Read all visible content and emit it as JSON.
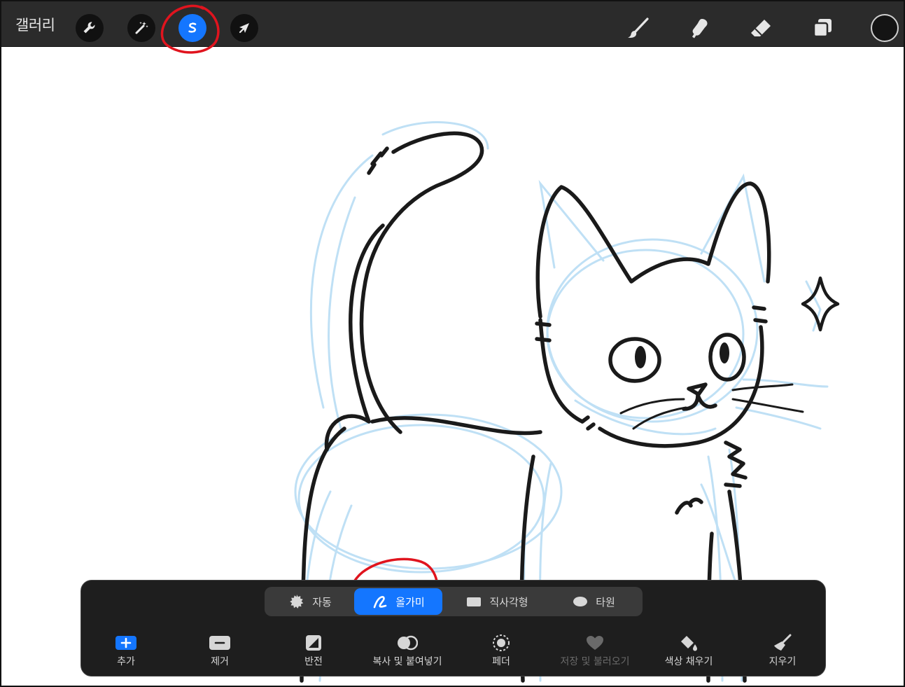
{
  "app": {
    "gallery_label": "갤러리"
  },
  "toolbar": {
    "left_tools": [
      {
        "name": "actions",
        "icon": "wrench-icon"
      },
      {
        "name": "adjustments",
        "icon": "magic-wand-icon"
      },
      {
        "name": "selection",
        "icon": "selection-s-icon",
        "active": true
      },
      {
        "name": "transform",
        "icon": "arrow-cursor-icon"
      }
    ],
    "right_tools": [
      {
        "name": "brush",
        "icon": "brush-icon"
      },
      {
        "name": "smudge",
        "icon": "smudge-icon"
      },
      {
        "name": "eraser",
        "icon": "eraser-icon"
      },
      {
        "name": "layers",
        "icon": "layers-icon"
      }
    ],
    "current_color": "#141414"
  },
  "selection_panel": {
    "modes": [
      {
        "label": "자동",
        "icon": "auto-select-icon",
        "active": false
      },
      {
        "label": "올가미",
        "icon": "lasso-icon",
        "active": true
      },
      {
        "label": "직사각형",
        "icon": "rectangle-icon",
        "active": false
      },
      {
        "label": "타원",
        "icon": "ellipse-icon",
        "active": false
      }
    ],
    "actions": [
      {
        "label": "추가",
        "icon": "add-icon",
        "enabled": true
      },
      {
        "label": "제거",
        "icon": "remove-icon",
        "enabled": true
      },
      {
        "label": "반전",
        "icon": "invert-icon",
        "enabled": true
      },
      {
        "label": "복사 및 붙여넣기",
        "icon": "copy-paste-icon",
        "enabled": true
      },
      {
        "label": "페더",
        "icon": "feather-icon",
        "enabled": true
      },
      {
        "label": "저장 및 불러오기",
        "icon": "heart-icon",
        "enabled": false
      },
      {
        "label": "색상 채우기",
        "icon": "color-fill-icon",
        "enabled": true
      },
      {
        "label": "지우기",
        "icon": "broom-icon",
        "enabled": true
      }
    ]
  },
  "colors": {
    "accent": "#1476ff",
    "toolbar_bg": "#2b2b2b",
    "panel_bg": "#1e1e1e",
    "sketch": "#bfe0f5",
    "ink": "#1a1a1a",
    "annotation": "#e0141e"
  }
}
